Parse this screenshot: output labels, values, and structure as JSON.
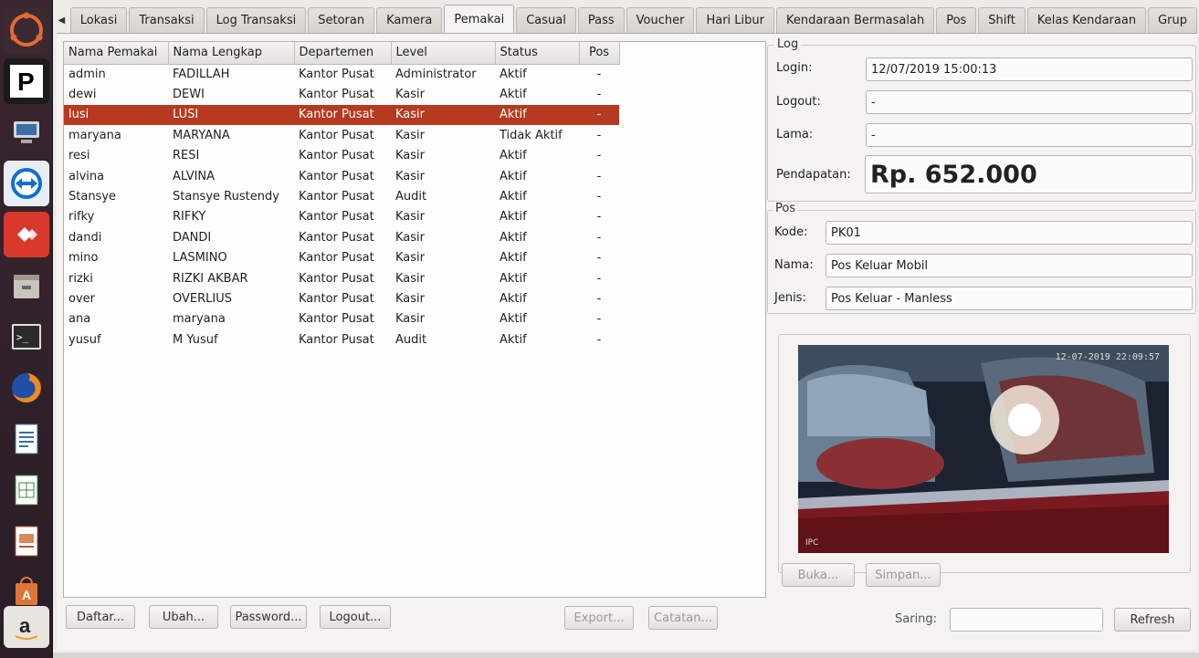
{
  "launcher": {
    "items": [
      {
        "name": "ubuntu-home",
        "icon": "ubuntu-logo-icon",
        "text": ""
      },
      {
        "name": "parking-app",
        "icon": "parking-p-icon",
        "text": "P"
      },
      {
        "name": "network-computer",
        "icon": "network-computer-icon",
        "text": ""
      },
      {
        "name": "teamviewer",
        "icon": "teamviewer-icon",
        "text": ""
      },
      {
        "name": "anydesk",
        "icon": "anydesk-icon",
        "text": ""
      },
      {
        "name": "file-manager",
        "icon": "file-manager-icon",
        "text": ""
      },
      {
        "name": "terminal",
        "icon": "terminal-icon",
        "text": ""
      },
      {
        "name": "firefox",
        "icon": "firefox-icon",
        "text": ""
      },
      {
        "name": "writer",
        "icon": "writer-icon",
        "text": ""
      },
      {
        "name": "calc",
        "icon": "calc-icon",
        "text": ""
      },
      {
        "name": "impress",
        "icon": "impress-icon",
        "text": ""
      },
      {
        "name": "software-center",
        "icon": "software-center-icon",
        "text": ""
      },
      {
        "name": "amazon",
        "icon": "amazon-icon",
        "text": "a"
      }
    ]
  },
  "tabs": [
    "Lokasi",
    "Transaksi",
    "Log Transaksi",
    "Setoran",
    "Kamera",
    "Pemakai",
    "Casual",
    "Pass",
    "Voucher",
    "Hari Libur",
    "Kendaraan Bermasalah",
    "Pos",
    "Shift",
    "Kelas Kendaraan",
    "Grup"
  ],
  "active_tab": "Pemakai",
  "table": {
    "headers": [
      "Nama Pemakai",
      "Nama Lengkap",
      "Departemen",
      "Level",
      "Status",
      "Pos"
    ],
    "rows": [
      [
        "admin",
        "FADILLAH",
        "Kantor Pusat",
        "Administrator",
        "Aktif",
        "-"
      ],
      [
        "dewi",
        "DEWI",
        "Kantor Pusat",
        "Kasir",
        "Aktif",
        "-"
      ],
      [
        "lusi",
        "LUSI",
        "Kantor Pusat",
        "Kasir",
        "Aktif",
        "-"
      ],
      [
        "maryana",
        "MARYANA",
        "Kantor Pusat",
        "Kasir",
        "Tidak Aktif",
        "-"
      ],
      [
        "resi",
        "RESI",
        "Kantor Pusat",
        "Kasir",
        "Aktif",
        "-"
      ],
      [
        "alvina",
        "ALVINA",
        "Kantor Pusat",
        "Kasir",
        "Aktif",
        "-"
      ],
      [
        "Stansye",
        "Stansye Rustendy",
        "Kantor Pusat",
        "Audit",
        "Aktif",
        "-"
      ],
      [
        "rifky",
        "RIFKY",
        "Kantor Pusat",
        "Kasir",
        "Aktif",
        "-"
      ],
      [
        "dandi",
        "DANDI",
        "Kantor Pusat",
        "Kasir",
        "Aktif",
        "-"
      ],
      [
        "mino",
        "LASMINO",
        "Kantor Pusat",
        "Kasir",
        "Aktif",
        "-"
      ],
      [
        "rizki",
        "RIZKI AKBAR",
        "Kantor Pusat",
        "Kasir",
        "Aktif",
        "-"
      ],
      [
        "over",
        "OVERLIUS",
        "Kantor Pusat",
        "Kasir",
        "Aktif",
        "-"
      ],
      [
        "ana",
        "maryana",
        "Kantor Pusat",
        "Kasir",
        "Aktif",
        "-"
      ],
      [
        "yusuf",
        "M Yusuf",
        "Kantor Pusat",
        "Audit",
        "Aktif",
        "-"
      ]
    ],
    "selected_row": 2
  },
  "buttons": {
    "daftar": "Daftar...",
    "ubah": "Ubah...",
    "password": "Password...",
    "logout": "Logout...",
    "export": "Export...",
    "catatan": "Catatan...",
    "buka": "Buka...",
    "simpan": "Simpan...",
    "refresh": "Refresh"
  },
  "log": {
    "title": "Log",
    "login_label": "Login:",
    "login_value": "12/07/2019 15:00:13",
    "logout_label": "Logout:",
    "logout_value": "-",
    "lama_label": "Lama:",
    "lama_value": "-",
    "pendapatan_label": "Pendapatan:",
    "pendapatan_value": "Rp. 652.000"
  },
  "pos": {
    "title": "Pos",
    "kode_label": "Kode:",
    "kode_value": "PK01",
    "nama_label": "Nama:",
    "nama_value": "Pos Keluar Mobil",
    "jenis_label": "Jenis:",
    "jenis_value": "Pos Keluar - Manless"
  },
  "camera": {
    "timestamp": "12-07-2019 22:09:57",
    "label": "IPC"
  },
  "filter": {
    "label": "Saring:",
    "value": ""
  },
  "colors": {
    "selection": "#b63a1f",
    "launcher": "#2f2128"
  }
}
